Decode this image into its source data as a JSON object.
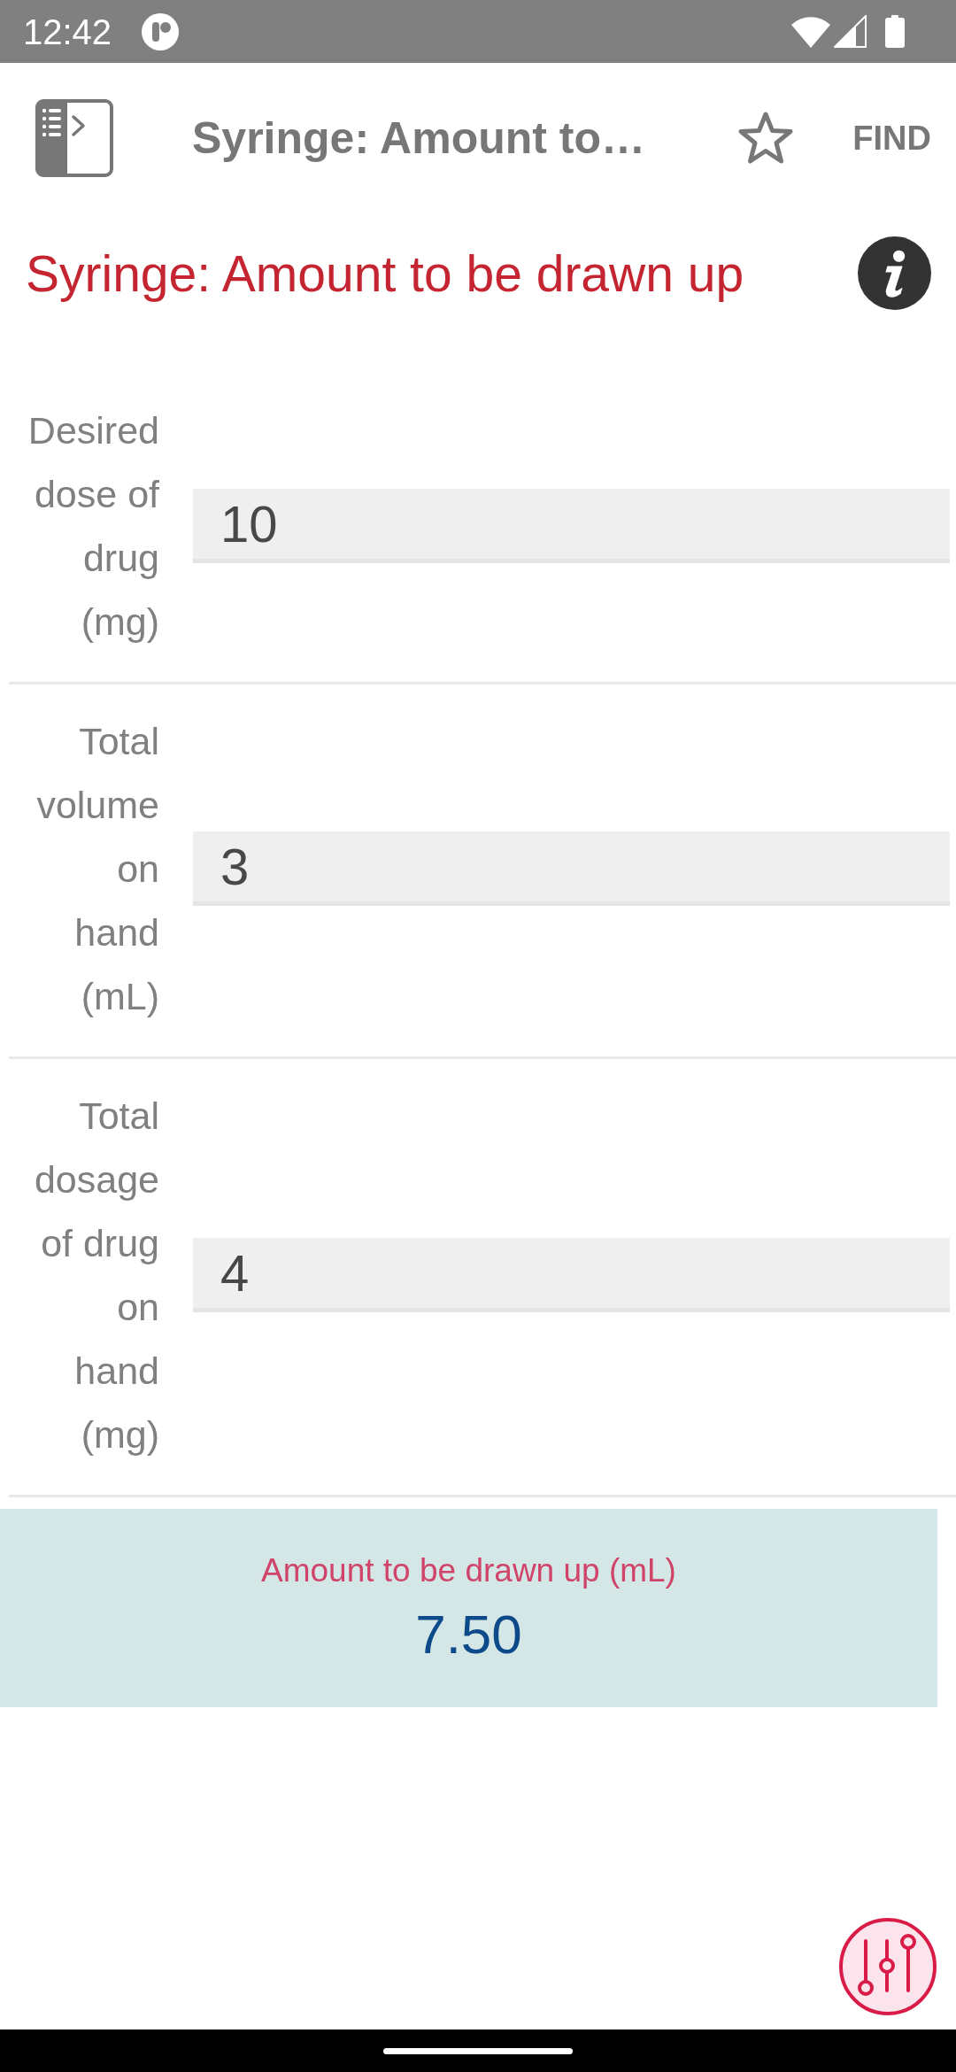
{
  "status_bar": {
    "time": "12:42"
  },
  "app_bar": {
    "title": "Syringe: Amount to…",
    "starred": false,
    "action": "FIND"
  },
  "heading": {
    "title": "Syringe: Amount to be drawn up"
  },
  "inputs": [
    {
      "label": "Desired dose of drug (mg)",
      "value": "10"
    },
    {
      "label": "Total volume on hand (mL)",
      "value": "3"
    },
    {
      "label": "Total dosage of drug on hand (mg)",
      "value": "4"
    }
  ],
  "result": {
    "label": "Amount to be drawn up (mL)",
    "value": "7.50"
  }
}
